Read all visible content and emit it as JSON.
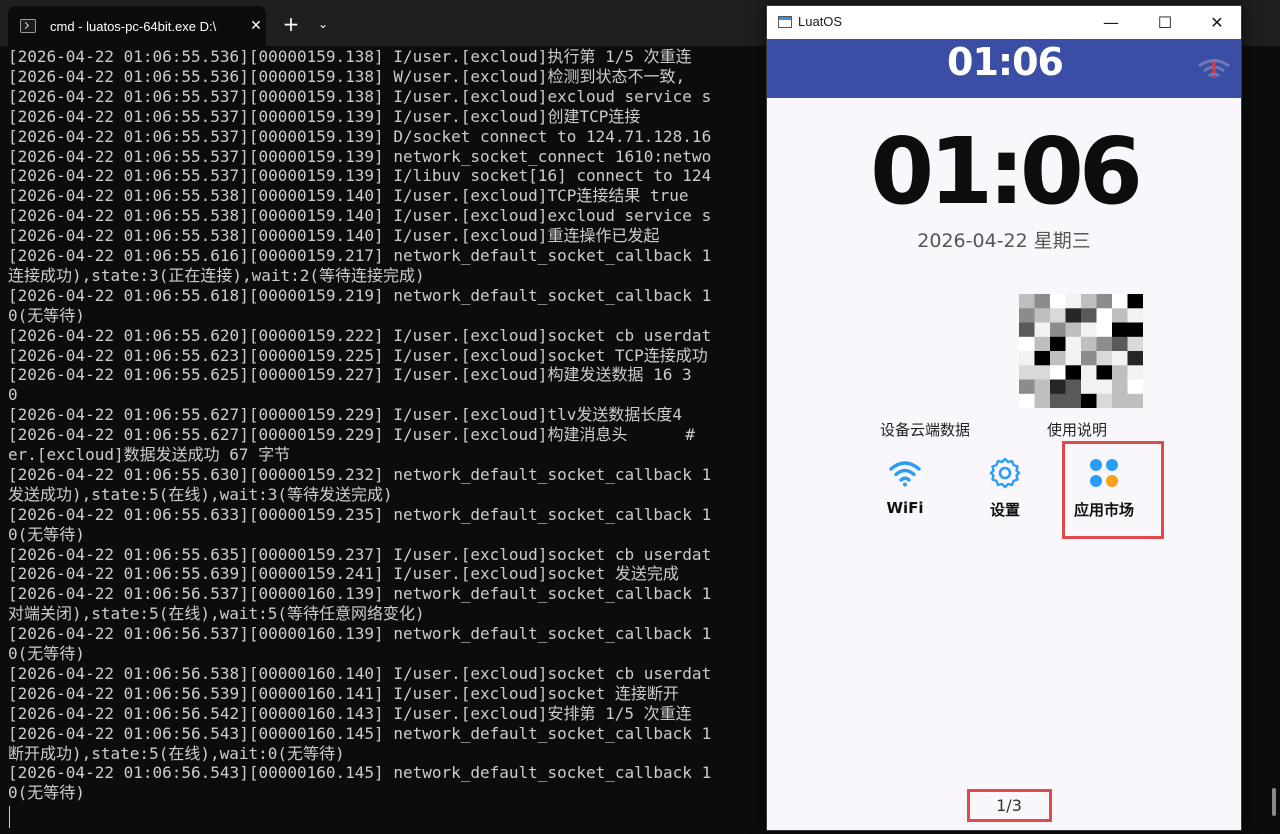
{
  "terminal": {
    "tab_title": "cmd - luatos-pc-64bit.exe  D:\\",
    "close_glyph": "✕",
    "newtab_glyph": "+",
    "dropdown_glyph": "⌄",
    "lines": [
      "[2026-04-22 01:06:55.536][00000159.138] I/user.[excloud]执行第 1/5 次重连",
      "[2026-04-22 01:06:55.536][00000159.138] W/user.[excloud]检测到状态不一致,",
      "[2026-04-22 01:06:55.537][00000159.138] I/user.[excloud]excloud service s",
      "[2026-04-22 01:06:55.537][00000159.139] I/user.[excloud]创建TCP连接",
      "[2026-04-22 01:06:55.537][00000159.139] D/socket connect to 124.71.128.16",
      "[2026-04-22 01:06:55.537][00000159.139] network_socket_connect 1610:netwo",
      "[2026-04-22 01:06:55.537][00000159.139] I/libuv socket[16] connect to 124",
      "[2026-04-22 01:06:55.538][00000159.140] I/user.[excloud]TCP连接结果 true",
      "[2026-04-22 01:06:55.538][00000159.140] I/user.[excloud]excloud service s",
      "[2026-04-22 01:06:55.538][00000159.140] I/user.[excloud]重连操作已发起",
      "[2026-04-22 01:06:55.616][00000159.217] network_default_socket_callback 1",
      "连接成功),state:3(正在连接),wait:2(等待连接完成)",
      "[2026-04-22 01:06:55.618][00000159.219] network_default_socket_callback 1                               :",
      "0(无等待)",
      "[2026-04-22 01:06:55.620][00000159.222] I/user.[excloud]socket cb userdat",
      "[2026-04-22 01:06:55.623][00000159.225] I/user.[excloud]socket TCP连接成功",
      "[2026-04-22 01:06:55.625][00000159.227] I/user.[excloud]构建发送数据 16 3                               0",
      "0",
      "[2026-04-22 01:06:55.627][00000159.229] I/user.[excloud]tlv发送数据长度4",
      "[2026-04-22 01:06:55.627][00000159.229] I/user.[excloud]构建消息头      #                               s",
      "er.[excloud]数据发送成功 67 字节",
      "[2026-04-22 01:06:55.630][00000159.232] network_default_socket_callback 1",
      "发送成功),state:5(在线),wait:3(等待发送完成)",
      "[2026-04-22 01:06:55.633][00000159.235] network_default_socket_callback 1                               :",
      "0(无等待)",
      "[2026-04-22 01:06:55.635][00000159.237] I/user.[excloud]socket cb userdat",
      "[2026-04-22 01:06:55.639][00000159.241] I/user.[excloud]socket 发送完成",
      "[2026-04-22 01:06:56.537][00000160.139] network_default_socket_callback 1",
      "对端关闭),state:5(在线),wait:5(等待任意网络变化)",
      "[2026-04-22 01:06:56.537][00000160.139] network_default_socket_callback 1                               :",
      "0(无等待)",
      "[2026-04-22 01:06:56.538][00000160.140] I/user.[excloud]socket cb userdat",
      "[2026-04-22 01:06:56.539][00000160.141] I/user.[excloud]socket 连接断开",
      "[2026-04-22 01:06:56.542][00000160.143] I/user.[excloud]安排第 1/5 次重连",
      "[2026-04-22 01:06:56.543][00000160.145] network_default_socket_callback 1",
      "断开成功),state:5(在线),wait:0(无等待)",
      "[2026-04-22 01:06:56.543][00000160.145] network_default_socket_callback 1                               :",
      "0(无等待)"
    ]
  },
  "luatos": {
    "window_title": "LuatOS",
    "controls": {
      "minimize": "—",
      "maximize": "☐",
      "close": "✕"
    },
    "status_time": "01:06",
    "big_time": "01:06",
    "date": "2026-04-22  星期三",
    "labels": {
      "cloud": "设备云端数据",
      "manual": "使用说明"
    },
    "apps": [
      {
        "label": "WiFi",
        "icon": "wifi-icon"
      },
      {
        "label": "设置",
        "icon": "gear-icon"
      },
      {
        "label": "应用市场",
        "icon": "app-market-icon"
      }
    ],
    "page_indicator": "1/3",
    "colors": {
      "status_bar": "#3a4ea6",
      "highlight": "#e04a4a",
      "wifi_blue": "#2a9df4",
      "market_orange": "#f7a01b"
    }
  }
}
